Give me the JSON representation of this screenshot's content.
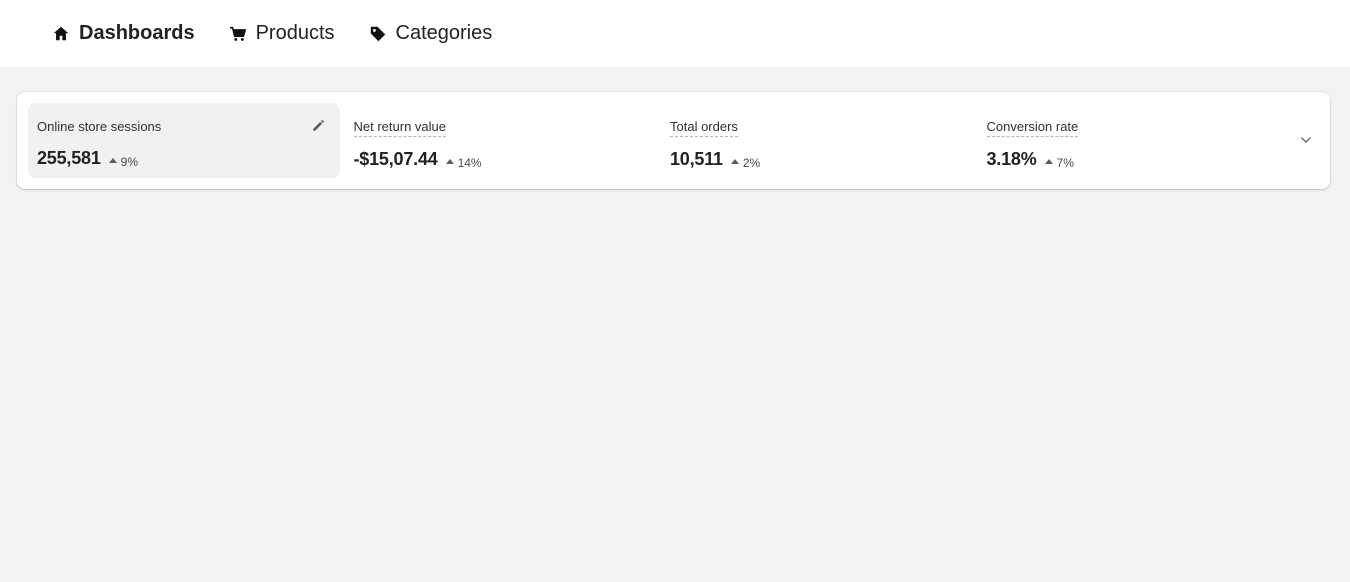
{
  "nav": {
    "items": [
      {
        "label": "Dashboards",
        "icon": "home-icon",
        "active": true
      },
      {
        "label": "Products",
        "icon": "cart-icon",
        "active": false
      },
      {
        "label": "Categories",
        "icon": "tag-icon",
        "active": false
      }
    ]
  },
  "metrics": [
    {
      "label": "Online store sessions",
      "value": "255,581",
      "change": "9%",
      "selected": true
    },
    {
      "label": "Net return value",
      "value": "-$15,07.44",
      "change": "14%",
      "selected": false
    },
    {
      "label": "Total orders",
      "value": "10,511",
      "change": "2%",
      "selected": false
    },
    {
      "label": "Conversion rate",
      "value": "3.18%",
      "change": "7%",
      "selected": false
    }
  ],
  "colors": {
    "background": "#f2f2f2",
    "surface": "#ffffff",
    "selected": "#f1f1f1",
    "text": "#202223"
  }
}
